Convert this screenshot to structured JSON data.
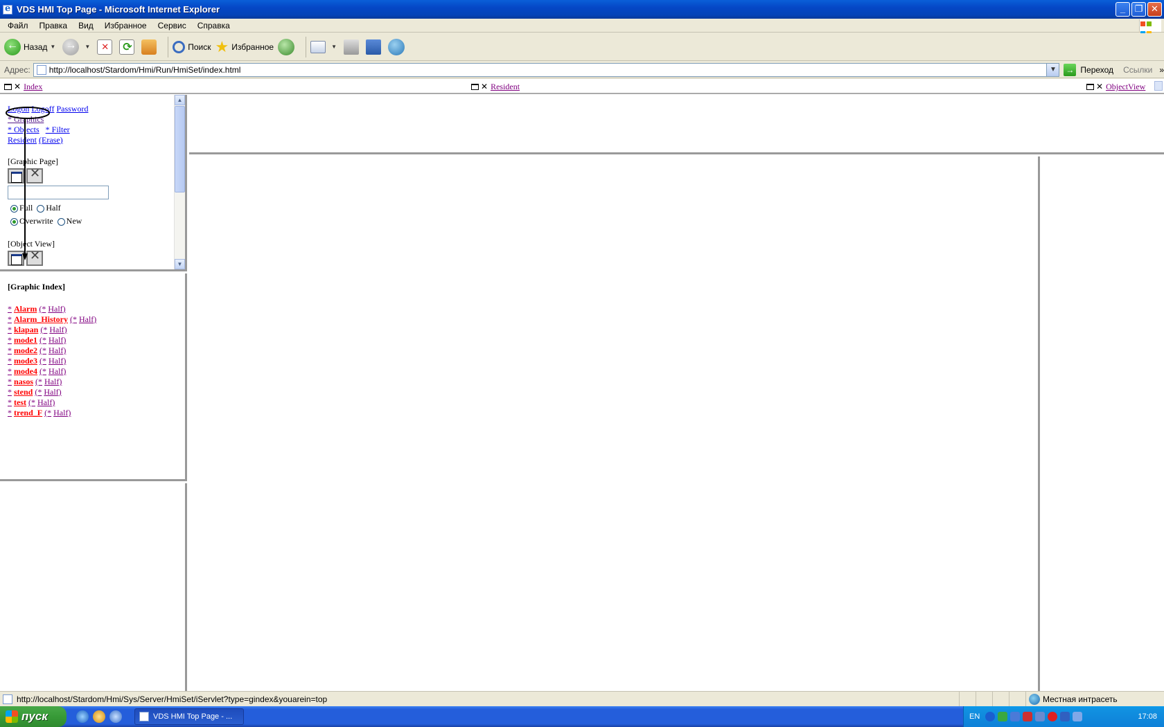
{
  "window": {
    "title": "VDS HMI Top Page - Microsoft Internet Explorer"
  },
  "menu": [
    "Файл",
    "Правка",
    "Вид",
    "Избранное",
    "Сервис",
    "Справка"
  ],
  "toolbar": {
    "back_label": "Назад",
    "search_label": "Поиск",
    "favorites_label": "Избранное"
  },
  "address": {
    "label": "Адрес:",
    "url": "http://localhost/Stardom/Hmi/Run/HmiSet/index.html",
    "go_label": "Переход",
    "links_label": "Ссылки"
  },
  "frame_tabs": {
    "index": "Index",
    "resident": "Resident",
    "objectview": "ObjectView"
  },
  "left_top": {
    "logon": "Logon",
    "logoff": "Logoff",
    "password": "Password",
    "graphics": "* Graphics",
    "objects": "* Objects",
    "filter": "* Filter",
    "resident": "Resident",
    "erase": "(Erase)",
    "graphic_page": "[Graphic Page]",
    "full": "Full",
    "half": "Half",
    "overwrite": "Overwrite",
    "new": "New",
    "object_view": "[Object View]"
  },
  "graphic_index": {
    "title": "[Graphic Index]",
    "star": "*",
    "open": "(*",
    "half": "Half)",
    "items": [
      "Alarm",
      "Alarm_History",
      "klapan",
      "mode1",
      "mode2",
      "mode3",
      "mode4",
      "nasos",
      "stend",
      "test",
      "trend_F"
    ]
  },
  "status": {
    "text": "http://localhost/Stardom/Hmi/Sys/Server/HmiSet/iServlet?type=gindex&youarein=top",
    "zone": "Местная интрасеть"
  },
  "taskbar": {
    "start": "пуск",
    "task": "VDS HMI Top Page - ...",
    "lang": "EN",
    "clock": "17:08"
  }
}
